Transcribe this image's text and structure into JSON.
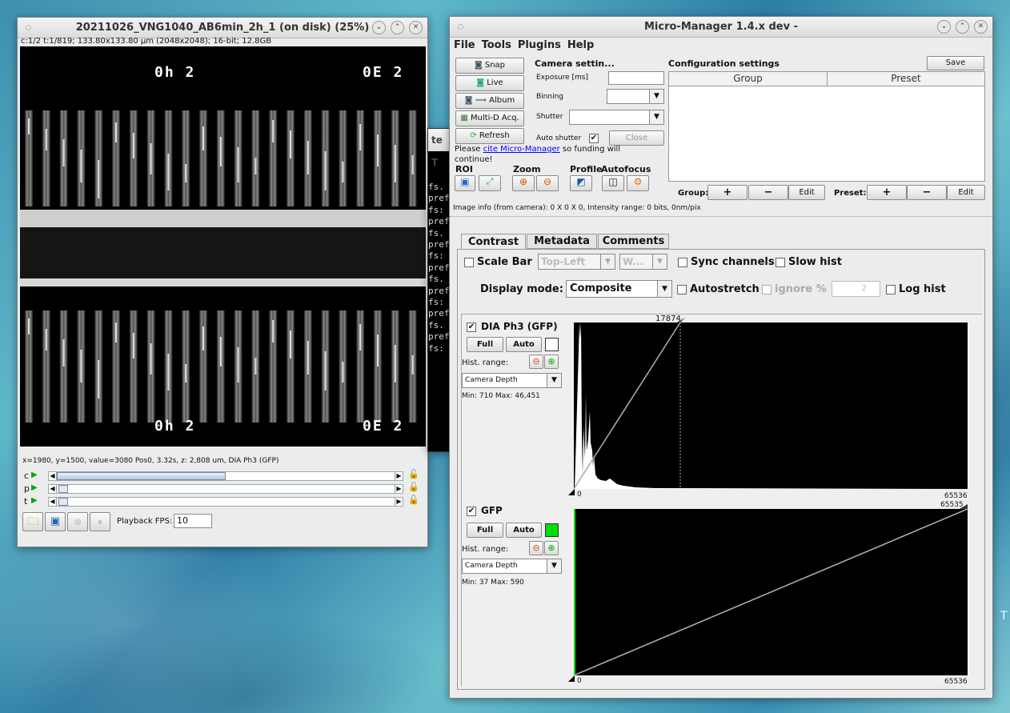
{
  "image_window": {
    "title": "20211026_VNG1040_AB6min_2h_1 (on disk) (25%)",
    "info": "c:1/2 t:1/819; 133.80x133.80 µm (2048x2048); 16-bit; 12.8GB",
    "overlay_tl": "0h 2",
    "overlay_tr": "0E 2",
    "overlay_bl": "0h 2",
    "overlay_br": "0E 2",
    "status": "x=1980, y=1500, value=3080   Pos0, 3.32s, z: 2,808 um,  DIA Ph3 (GFP)",
    "sliders": [
      {
        "label": "c",
        "pos": 0.51
      },
      {
        "label": "p",
        "pos": 0.0
      },
      {
        "label": "t",
        "pos": 0.0
      }
    ],
    "fps_label": "Playback FPS:",
    "fps_value": "10"
  },
  "console": {
    "title": "te T",
    "lines": [
      "fs.",
      "pref",
      "fs:",
      "pref",
      "fs.",
      "pref",
      "fs:",
      "pref",
      "fs.",
      "pref",
      "fs:",
      "pref",
      "fs.",
      "pref",
      "fs:"
    ]
  },
  "mm": {
    "title": "Micro-Manager 1.4.x dev -",
    "menu": [
      "File",
      "Tools",
      "Plugins",
      "Help"
    ],
    "buttons": {
      "snap": "Snap",
      "live": "Live",
      "album": "Album",
      "multid": "Multi-D Acq.",
      "refresh": "Refresh"
    },
    "camera_header": "Camera settin...",
    "exposure_label": "Exposure [ms]",
    "binning_label": "Binning",
    "shutter_label": "Shutter",
    "auto_shutter": "Auto shutter",
    "close": "Close",
    "cite_pre": "Please ",
    "cite_link": "cite Micro-Manager",
    "cite_post": " so funding will",
    "cite_line2": "continue!",
    "roi": "ROI",
    "zoom": "Zoom",
    "profile": "Profile",
    "autofocus": "Autofocus",
    "config_header": "Configuration settings",
    "save": "Save",
    "col_group": "Group",
    "col_preset": "Preset",
    "group_label": "Group:",
    "preset_label": "Preset:",
    "plus": "+",
    "minus": "−",
    "edit": "Edit",
    "image_info": "Image info (from camera): 0 X 0 X 0, Intensity range: 0 bits, 0nm/pix",
    "tabs": [
      "Contrast",
      "Metadata",
      "Comments"
    ],
    "scale_bar": "Scale Bar",
    "scale_pos": "Top-Left",
    "scale_w": "W...",
    "sync": "Sync channels",
    "slow": "Slow hist",
    "display_mode_label": "Display mode:",
    "display_mode": "Composite",
    "autostretch": "Autostretch",
    "ignore": "ignore %",
    "ignore_val": "2",
    "log_hist": "Log hist",
    "channels": [
      {
        "name": "DIA Ph3 (GFP)",
        "full": "Full",
        "auto": "Auto",
        "color": "#ffffff",
        "hist_range": "Hist. range:",
        "depth": "Camera Depth",
        "minmax": "Min: 710   Max: 46,451",
        "top_label": "17874",
        "axis_min": "0",
        "axis_max": "65536"
      },
      {
        "name": "GFP",
        "full": "Full",
        "auto": "Auto",
        "color": "#00dd00",
        "hist_range": "Hist. range:",
        "depth": "Camera Depth",
        "minmax": "Min: 37   Max: 590",
        "top_label": "65535",
        "axis_min": "0",
        "axis_max": "65536"
      }
    ]
  }
}
